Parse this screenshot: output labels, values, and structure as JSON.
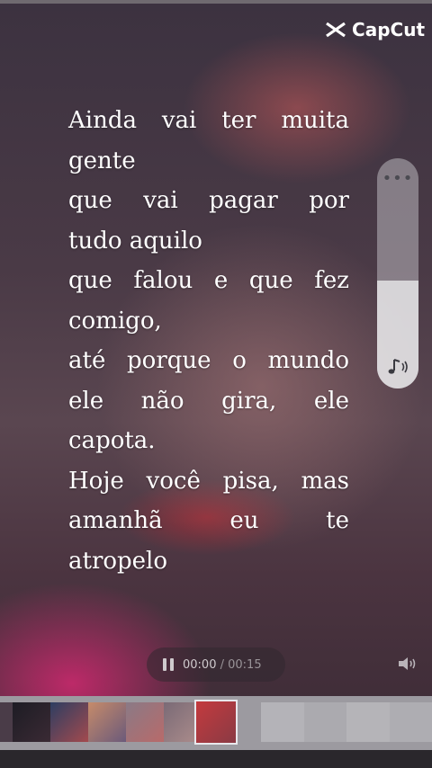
{
  "brand": {
    "name": "CapCut",
    "icon": "capcut-logo-icon"
  },
  "lyrics": {
    "lines": [
      "Ainda vai ter muita",
      "gente",
      "que vai pagar por",
      "tudo aquilo",
      "que falou e que fez",
      "comigo,",
      "até porque o mundo",
      "ele não gira, ele",
      "capota.",
      "Hoje você pisa, mas",
      "amanhã eu te",
      "atropelo"
    ]
  },
  "volume_panel": {
    "menu_icon": "more-dots-icon",
    "music_icon": "music-note-icon",
    "level": 0.47
  },
  "player": {
    "current_time": "00:00",
    "separator": " / ",
    "total_time": "00:15",
    "pause_icon": "pause-icon",
    "speaker_icon": "speaker-icon"
  },
  "colors": {
    "text": "#ffffff",
    "accent_pink": "#e6287a",
    "panel": "#d2d2d7"
  }
}
